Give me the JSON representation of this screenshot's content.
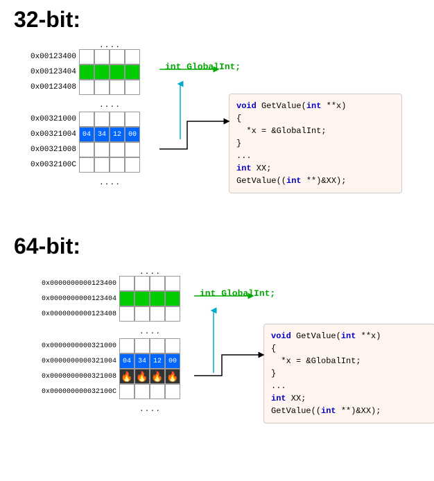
{
  "sections": [
    {
      "id": "32bit",
      "title": "32-bit:",
      "memory_top": {
        "dots": "· · · ·",
        "rows": [
          {
            "label": "0x00123400",
            "cells": [
              "empty",
              "empty",
              "empty",
              "empty"
            ],
            "highlight": "none"
          },
          {
            "label": "0x00123404",
            "cells": [
              "green",
              "green",
              "green",
              "green"
            ],
            "highlight": "green"
          },
          {
            "label": "0x00123408",
            "cells": [
              "empty",
              "empty",
              "empty",
              "empty"
            ],
            "highlight": "none"
          }
        ],
        "dots_after": "· · · ·"
      },
      "global_int_label": "int GlobalInt;",
      "memory_bottom": {
        "rows": [
          {
            "label": "0x00321000",
            "cells": [
              "empty",
              "empty",
              "empty",
              "empty"
            ],
            "highlight": "none"
          },
          {
            "label": "0x00321004",
            "cells": [
              "04",
              "34",
              "12",
              "00"
            ],
            "highlight": "blue"
          },
          {
            "label": "0x00321008",
            "cells": [
              "empty",
              "empty",
              "empty",
              "empty"
            ],
            "highlight": "none"
          },
          {
            "label": "0x0032100C",
            "cells": [
              "empty",
              "empty",
              "empty",
              "empty"
            ],
            "highlight": "none"
          }
        ],
        "dots_after": "· · · ·"
      },
      "code": {
        "line1": "void GetValue(int **x)",
        "line2": "{",
        "line3": "  *x = &GlobalInt;",
        "line4": "}",
        "line5": "...",
        "line6": "int XX;",
        "line7": "GetValue((int **)&XX);"
      }
    },
    {
      "id": "64bit",
      "title": "64-bit:",
      "memory_top": {
        "dots": "· · · ·",
        "rows": [
          {
            "label": "0x0000000000123400",
            "cells": [
              "empty",
              "empty",
              "empty",
              "empty"
            ],
            "highlight": "none"
          },
          {
            "label": "0x0000000000123404",
            "cells": [
              "green",
              "green",
              "green",
              "green"
            ],
            "highlight": "green"
          },
          {
            "label": "0x0000000000123408",
            "cells": [
              "empty",
              "empty",
              "empty",
              "empty"
            ],
            "highlight": "none"
          }
        ],
        "dots_after": "· · · ·"
      },
      "global_int_label": "int GlobalInt;",
      "memory_bottom": {
        "rows": [
          {
            "label": "0x0000000000321000",
            "cells": [
              "empty",
              "empty",
              "empty",
              "empty"
            ],
            "highlight": "none"
          },
          {
            "label": "0x0000000000321004",
            "cells": [
              "04",
              "34",
              "12",
              "00"
            ],
            "highlight": "blue"
          },
          {
            "label": "0x0000000000321008",
            "cells": [
              "flame",
              "flame",
              "flame",
              "flame"
            ],
            "highlight": "flame"
          },
          {
            "label": "0x000000000032100C",
            "cells": [
              "empty",
              "empty",
              "empty",
              "empty"
            ],
            "highlight": "none"
          }
        ],
        "dots_after": "· · · ·"
      },
      "code": {
        "line1": "void GetValue(int **x)",
        "line2": "{",
        "line3": "  *x = &GlobalInt;",
        "line4": "}",
        "line5": "...",
        "line6": "int XX;",
        "line7": "GetValue((int **)&XX);"
      }
    }
  ]
}
